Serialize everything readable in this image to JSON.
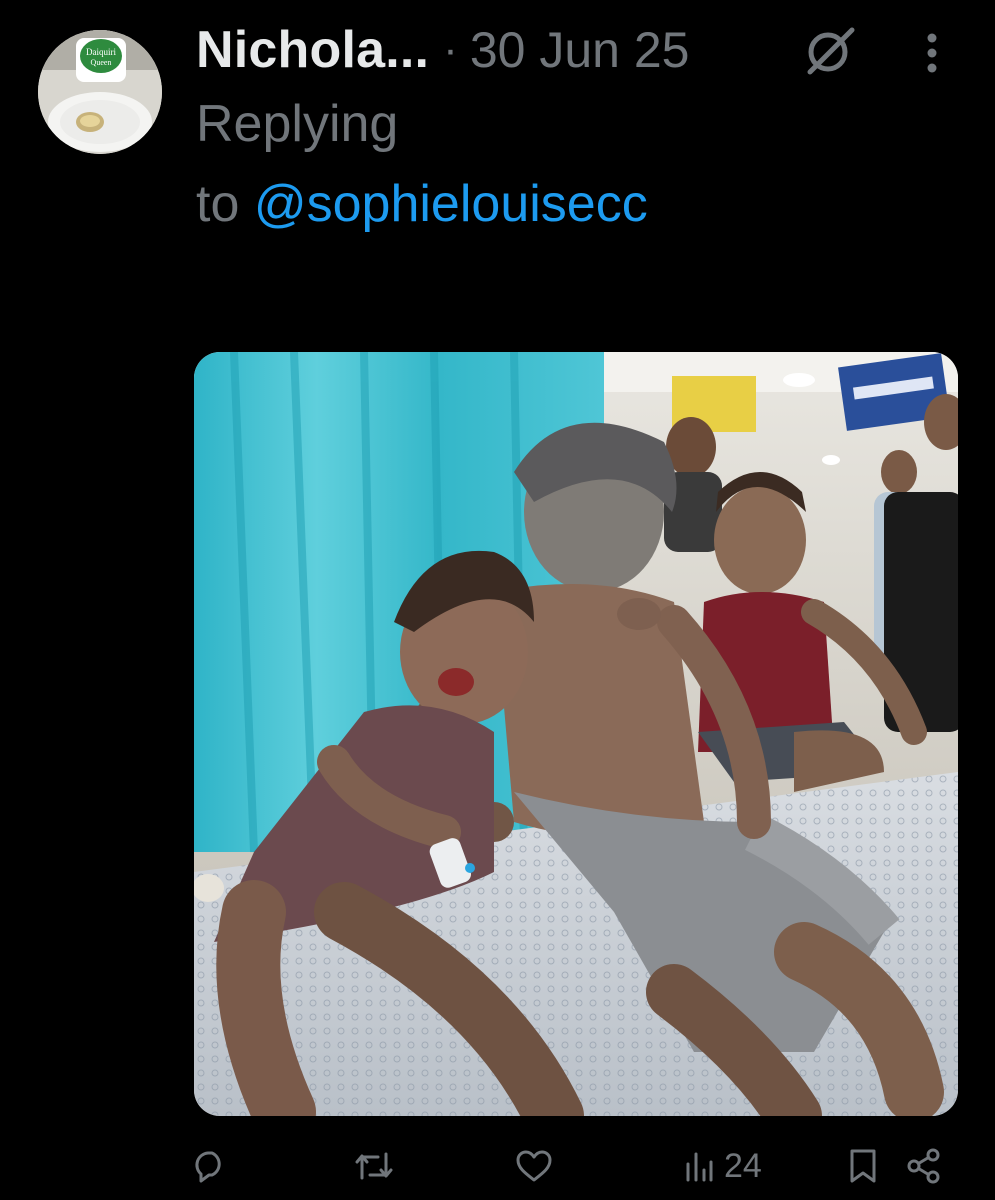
{
  "tweet": {
    "author": {
      "display_name": "Nichola...",
      "avatar_icon": "avatar-daiquiri-queen"
    },
    "separator": "·",
    "timestamp": "30 Jun 25",
    "reply_prefix_line1": "Replying",
    "reply_prefix_line2": "to ",
    "reply_to_handle": "@sophielouisecc",
    "media": {
      "type": "photo",
      "description": ""
    },
    "actions": {
      "reply_icon": "reply-icon",
      "retweet_icon": "retweet-icon",
      "like_icon": "like-icon",
      "views_icon": "views-icon",
      "views_count": "24",
      "bookmark_icon": "bookmark-icon",
      "share_icon": "share-icon"
    },
    "header_icons": {
      "grok": "grok-icon",
      "more": "more-icon"
    }
  },
  "colors": {
    "background": "#000000",
    "primary_text": "#e7e9ea",
    "secondary_text": "#71767b",
    "link": "#1d9bf0"
  }
}
